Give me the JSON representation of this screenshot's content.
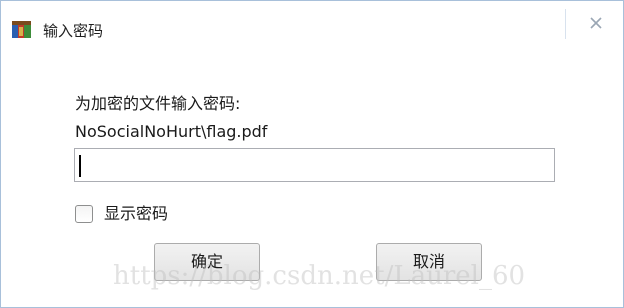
{
  "window": {
    "title": "输入密码",
    "icon": "winrar-archive-icon",
    "close_glyph": "✕"
  },
  "dialog": {
    "prompt": "为加密的文件输入密码:",
    "filename": "NoSocialNoHurt\\flag.pdf",
    "password_value": "",
    "show_password_label": "显示密码",
    "show_password_checked": false,
    "ok_label": "确定",
    "cancel_label": "取消"
  },
  "watermark": {
    "text": "https://blog.csdn.net/Laurel_60"
  }
}
